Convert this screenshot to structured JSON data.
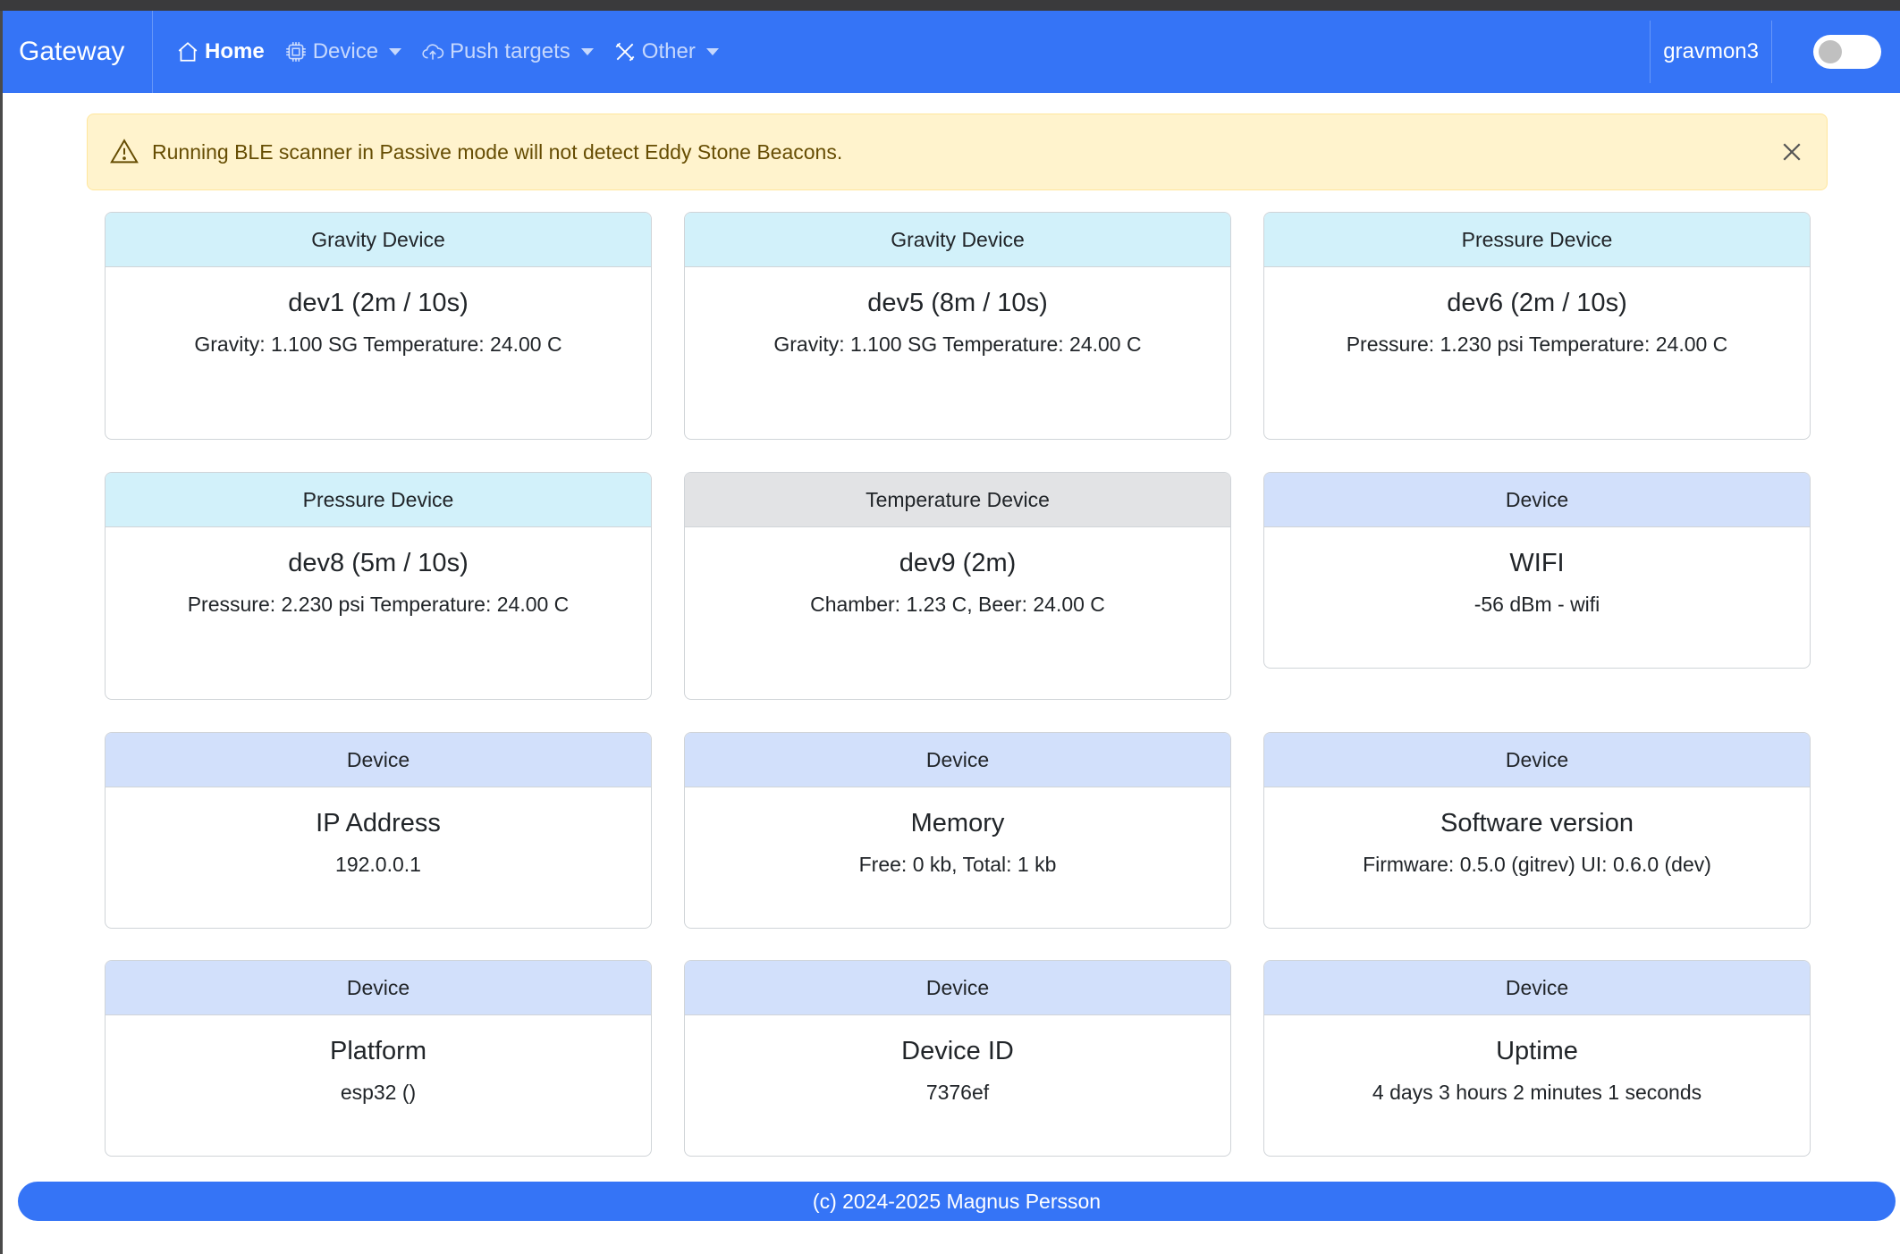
{
  "navbar": {
    "brand": "Gateway",
    "items": [
      {
        "label": "Home",
        "icon": "house-icon"
      },
      {
        "label": "Device",
        "icon": "cpu-icon"
      },
      {
        "label": "Push targets",
        "icon": "cloud-upload-icon"
      },
      {
        "label": "Other",
        "icon": "tools-icon"
      }
    ],
    "hostname": "gravmon3",
    "toggle_on": false
  },
  "alert": {
    "message": "Running BLE scanner in Passive mode will not detect Eddy Stone Beacons."
  },
  "cards": [
    {
      "header": "Gravity Device",
      "title": "dev1 (2m / 10s)",
      "text": "Gravity: 1.100 SG Temperature: 24.00 C"
    },
    {
      "header": "Gravity Device",
      "title": "dev5 (8m / 10s)",
      "text": "Gravity: 1.100 SG Temperature: 24.00 C"
    },
    {
      "header": "Pressure Device",
      "title": "dev6 (2m / 10s)",
      "text": "Pressure: 1.230 psi Temperature: 24.00 C"
    },
    {
      "header": "Pressure Device",
      "title": "dev8 (5m / 10s)",
      "text": "Pressure: 2.230 psi Temperature: 24.00 C"
    },
    {
      "header": "Temperature Device",
      "title": "dev9 (2m)",
      "text": "Chamber: 1.23 C, Beer: 24.00 C"
    },
    {
      "header": "Device",
      "title": "WIFI",
      "text": "-56 dBm - wifi"
    },
    {
      "header": "Device",
      "title": "IP Address",
      "text": "192.0.0.1"
    },
    {
      "header": "Device",
      "title": "Memory",
      "text": "Free: 0 kb, Total: 1 kb"
    },
    {
      "header": "Device",
      "title": "Software version",
      "text": "Firmware: 0.5.0 (gitrev) UI: 0.6.0 (dev)"
    },
    {
      "header": "Device",
      "title": "Platform",
      "text": "esp32 ()"
    },
    {
      "header": "Device",
      "title": "Device ID",
      "text": "7376ef"
    },
    {
      "header": "Device",
      "title": "Uptime",
      "text": "4 days 3 hours 2 minutes 1 seconds"
    }
  ],
  "footer": {
    "text": "(c) 2024-2025 Magnus Persson"
  },
  "colors": {
    "primary": "#3574f6",
    "info_header": "#d2f1fa",
    "secondary_header": "#e2e3e5",
    "primary_header": "#d2e0fb",
    "warning_bg": "#fff3cd"
  }
}
